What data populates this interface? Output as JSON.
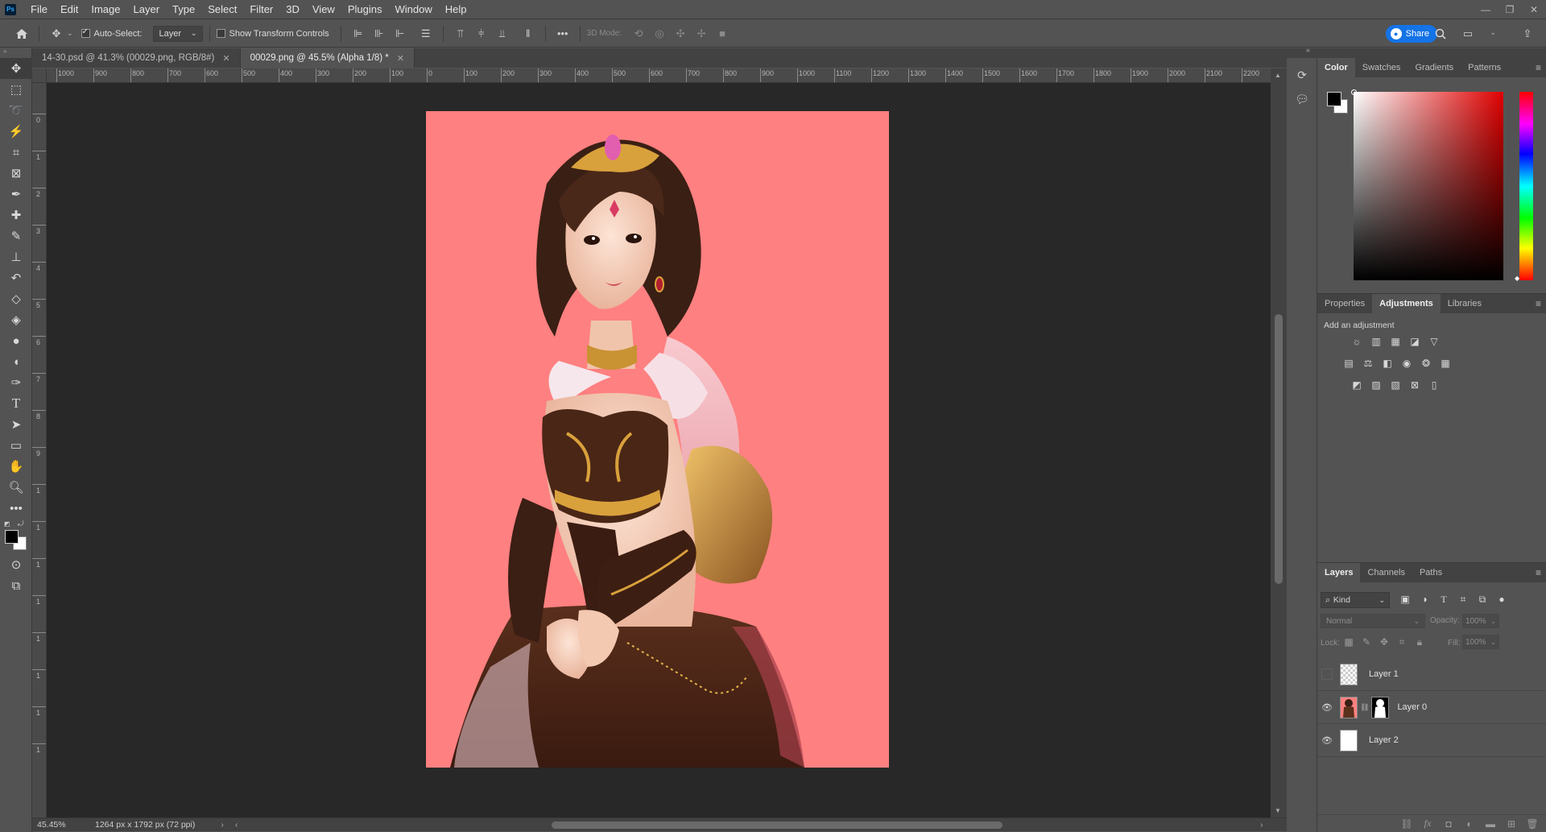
{
  "app": {
    "logo": "Ps"
  },
  "menu": [
    "File",
    "Edit",
    "Image",
    "Layer",
    "Type",
    "Select",
    "Filter",
    "3D",
    "View",
    "Plugins",
    "Window",
    "Help"
  ],
  "options": {
    "auto_select_label": "Auto-Select:",
    "auto_select_checked": true,
    "auto_select_target": "Layer",
    "show_transform_label": "Show Transform Controls",
    "show_transform_checked": false,
    "mode_3d_label": "3D Mode:",
    "share_label": "Share"
  },
  "tabs": [
    {
      "label": "14-30.psd @ 41.3% (00029.png, RGB/8#)",
      "active": false
    },
    {
      "label": "00029.png @ 45.5% (Alpha 1/8) *",
      "active": true
    }
  ],
  "ruler_h_labels": [
    "1000",
    "900",
    "800",
    "700",
    "600",
    "500",
    "400",
    "300",
    "200",
    "100",
    "0",
    "100",
    "200",
    "300",
    "400",
    "500",
    "600",
    "700",
    "800",
    "900",
    "1000",
    "1100",
    "1200",
    "1300",
    "1400",
    "1500",
    "1600",
    "1700",
    "1800",
    "1900",
    "2000",
    "2100",
    "2200"
  ],
  "ruler_v_labels": [
    "0",
    "1",
    "2",
    "3",
    "4",
    "5",
    "6",
    "7",
    "8",
    "9",
    "1",
    "1",
    "1",
    "1",
    "1",
    "1",
    "1",
    "1"
  ],
  "status": {
    "zoom": "45.45%",
    "doc_info": "1264 px x 1792 px (72 ppi)"
  },
  "color_panel": {
    "tabs": [
      "Color",
      "Swatches",
      "Gradients",
      "Patterns"
    ],
    "active_tab": "Color",
    "foreground": "#000000",
    "background": "#ffffff"
  },
  "adjust_panel": {
    "tabs": [
      "Properties",
      "Adjustments",
      "Libraries"
    ],
    "active_tab": "Adjustments",
    "heading": "Add an adjustment"
  },
  "layers_panel": {
    "tabs": [
      "Layers",
      "Channels",
      "Paths"
    ],
    "active_tab": "Layers",
    "filter_label": "Kind",
    "blend_mode": "Normal",
    "opacity_label": "Opacity:",
    "opacity_value": "100%",
    "lock_label": "Lock:",
    "fill_label": "Fill:",
    "fill_value": "100%",
    "layers": [
      {
        "name": "Layer 1",
        "visible": false
      },
      {
        "name": "Layer 0",
        "visible": true
      },
      {
        "name": "Layer 2",
        "visible": true
      }
    ]
  },
  "canvas": {
    "doc_bg": "#ff8080",
    "workspace_bg": "#282828"
  }
}
